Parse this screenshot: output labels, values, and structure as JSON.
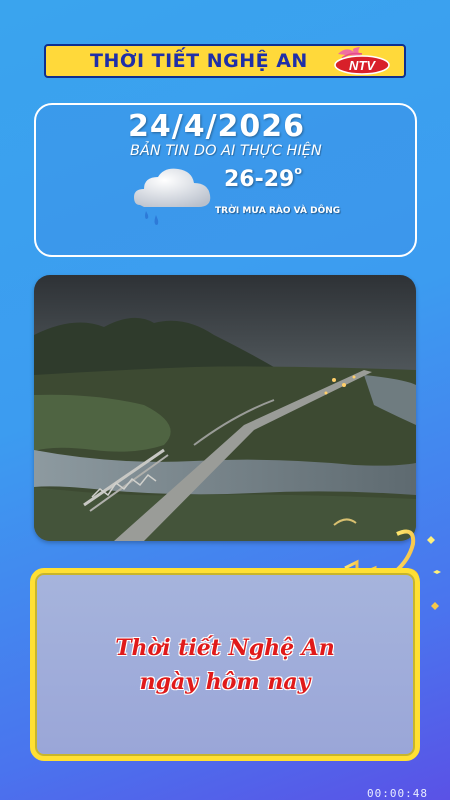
{
  "header": {
    "title": "THỜI TIẾT NGHỆ AN",
    "logo_text": "NTV"
  },
  "forecast": {
    "date": "24/4/2026",
    "subtitle": "BẢN TIN DO AI THỰC HIỆN",
    "temperature": "26-29",
    "temp_unit": "o",
    "condition": "TRỜI MƯA RÀO VÀ DÔNG",
    "icon": "rain-cloud-icon"
  },
  "media": {
    "photo": "aerial-river-bridge-photo"
  },
  "message": {
    "line1": "Thời tiết Nghệ An",
    "line2": "ngày hôm nay"
  },
  "playback": {
    "time": "00:00:48"
  },
  "colors": {
    "banner_bg": "#ffd93a",
    "banner_text": "#1f2fa8",
    "message_text": "#e01a1a",
    "panel_border": "#ffe033"
  }
}
